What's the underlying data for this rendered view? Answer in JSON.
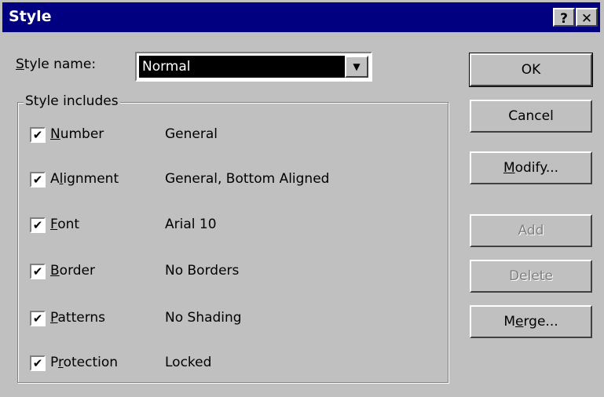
{
  "window": {
    "title": "Style",
    "help_label": "?",
    "close_label": "✕"
  },
  "style_name": {
    "label_accel": "S",
    "label_rest": "tyle name:",
    "value": "Normal",
    "dropdown_icon": "chevron-down-icon"
  },
  "group": {
    "title": "Style includes",
    "items": [
      {
        "pre": "",
        "accel": "N",
        "post": "umber",
        "value": "General",
        "checked": true
      },
      {
        "pre": "A",
        "accel": "l",
        "post": "ignment",
        "value": "General, Bottom Aligned",
        "checked": true
      },
      {
        "pre": "",
        "accel": "F",
        "post": "ont",
        "value": "Arial 10",
        "checked": true
      },
      {
        "pre": "",
        "accel": "B",
        "post": "order",
        "value": "No Borders",
        "checked": true
      },
      {
        "pre": "",
        "accel": "P",
        "post": "atterns",
        "value": "No Shading",
        "checked": true
      },
      {
        "pre": "P",
        "accel": "r",
        "post": "otection",
        "value": "Locked",
        "checked": true
      }
    ],
    "check_glyph": "✔"
  },
  "buttons": {
    "ok": "OK",
    "cancel": "Cancel",
    "modify_accel": "M",
    "modify_rest": "odify...",
    "add": "Add",
    "delete": "Delete",
    "merge_pre": "M",
    "merge_accel": "e",
    "merge_rest": "rge..."
  }
}
